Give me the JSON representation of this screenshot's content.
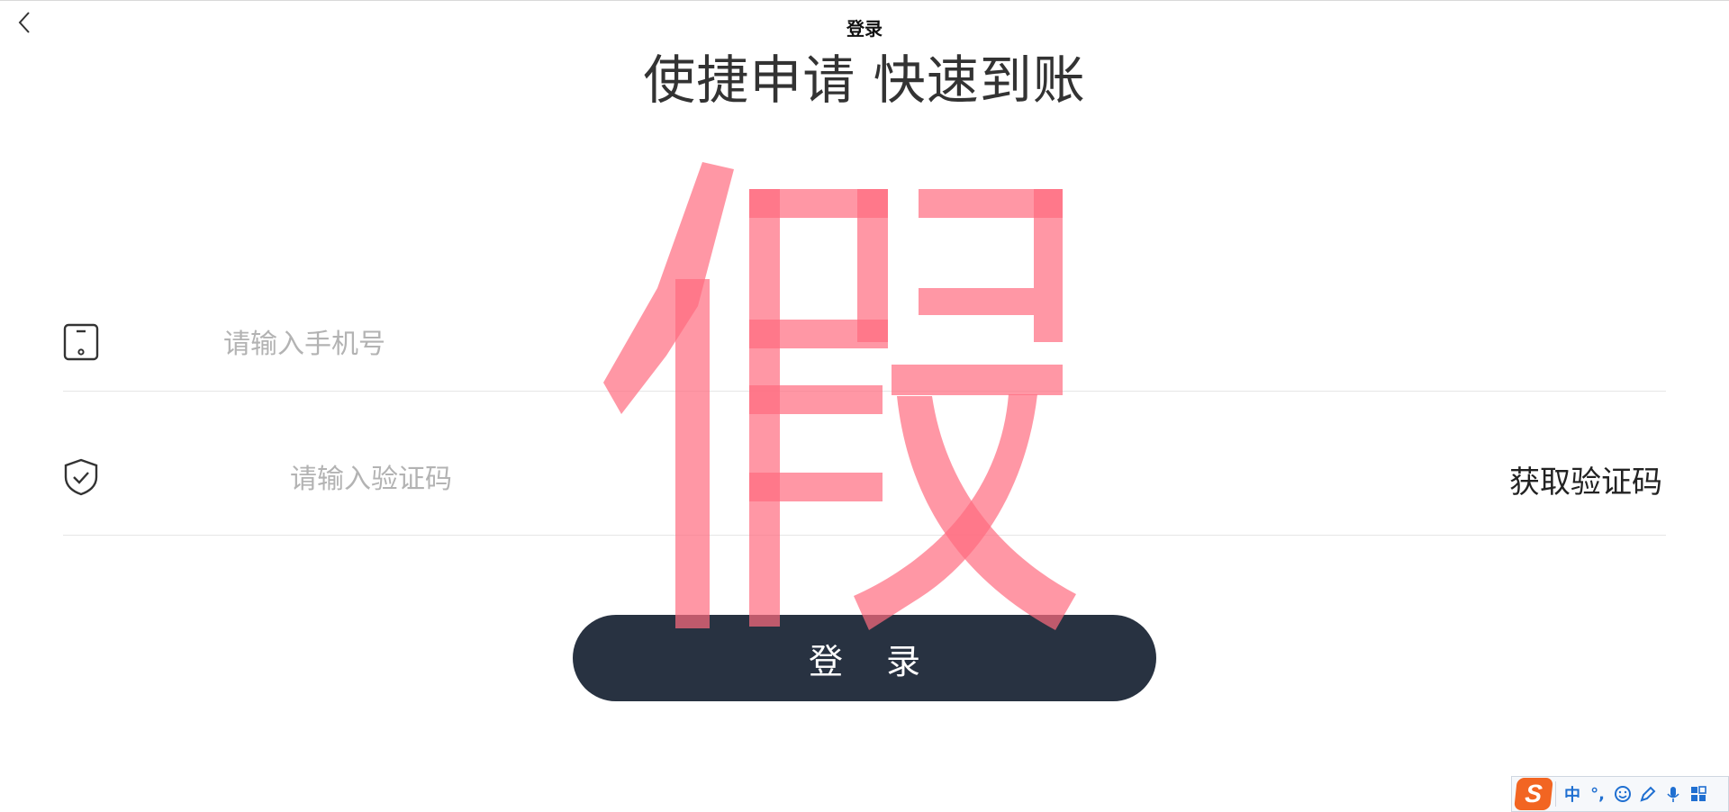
{
  "header": {
    "title": "登录",
    "slogan": "使捷申请 快速到账"
  },
  "form": {
    "phone": {
      "icon": "phone-icon",
      "placeholder": "请输入手机号",
      "value": ""
    },
    "code": {
      "icon": "shield-check-icon",
      "placeholder": "请输入验证码",
      "value": "",
      "get_code_label": "获取验证码"
    },
    "login_label": "登 录"
  },
  "watermark": {
    "text": "假",
    "color": "#ff6b7f"
  },
  "colors": {
    "button_bg": "#283241",
    "placeholder": "#b3b3b3",
    "ime_accent": "#1f6fd1",
    "ime_logo": "#f26522"
  },
  "ime_toolbar": {
    "logo": "S",
    "mode": "中",
    "punct": "°,",
    "icons": [
      "emoji-icon",
      "pen-icon",
      "mic-icon",
      "grid-icon"
    ]
  }
}
